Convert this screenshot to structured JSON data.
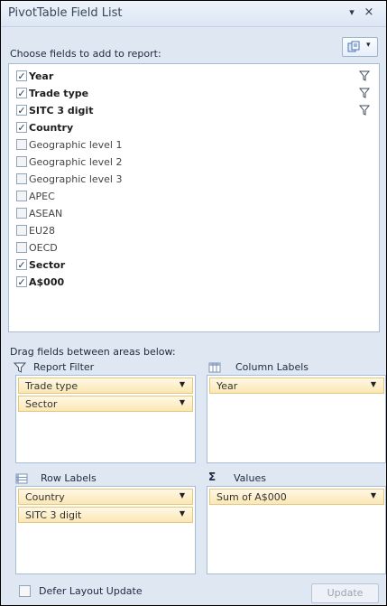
{
  "title": "PivotTable Field List",
  "title_buttons": {
    "dropdown_glyph": "▾",
    "close_glyph": "×"
  },
  "choose_label": "Choose fields to add to report:",
  "layout_button_dropdown": "▾",
  "fields": [
    {
      "name": "Year",
      "checked": true,
      "bold": true,
      "filtered": true
    },
    {
      "name": "Trade type",
      "checked": true,
      "bold": true,
      "filtered": true
    },
    {
      "name": "SITC 3 digit",
      "checked": true,
      "bold": true,
      "filtered": true
    },
    {
      "name": "Country",
      "checked": true,
      "bold": true,
      "filtered": false
    },
    {
      "name": "Geographic level 1",
      "checked": false,
      "bold": false,
      "filtered": false
    },
    {
      "name": "Geographic level 2",
      "checked": false,
      "bold": false,
      "filtered": false
    },
    {
      "name": "Geographic level 3",
      "checked": false,
      "bold": false,
      "filtered": false
    },
    {
      "name": "APEC",
      "checked": false,
      "bold": false,
      "filtered": false
    },
    {
      "name": "ASEAN",
      "checked": false,
      "bold": false,
      "filtered": false
    },
    {
      "name": "EU28",
      "checked": false,
      "bold": false,
      "filtered": false
    },
    {
      "name": "OECD",
      "checked": false,
      "bold": false,
      "filtered": false
    },
    {
      "name": "Sector",
      "checked": true,
      "bold": true,
      "filtered": false
    },
    {
      "name": "A$000",
      "checked": true,
      "bold": true,
      "filtered": false
    }
  ],
  "check_glyph": "✓",
  "drag_label": "Drag fields between areas below:",
  "areas": {
    "report_filter": {
      "label": "Report Filter",
      "items": [
        "Trade type",
        "Sector"
      ]
    },
    "column_labels": {
      "label": "Column Labels",
      "items": [
        "Year"
      ]
    },
    "row_labels": {
      "label": "Row Labels",
      "items": [
        "Country",
        "SITC 3 digit"
      ]
    },
    "values": {
      "label": "Values",
      "items": [
        "Sum of A$000"
      ]
    }
  },
  "chip_arrow": "▼",
  "values_icon": "Σ",
  "defer_label": "Defer Layout Update",
  "defer_checked": false,
  "update_label": "Update",
  "colors": {
    "chip_bg": "#fbe7b4",
    "panel_bg": "#dfe7f3",
    "border": "#a9bcd6"
  }
}
